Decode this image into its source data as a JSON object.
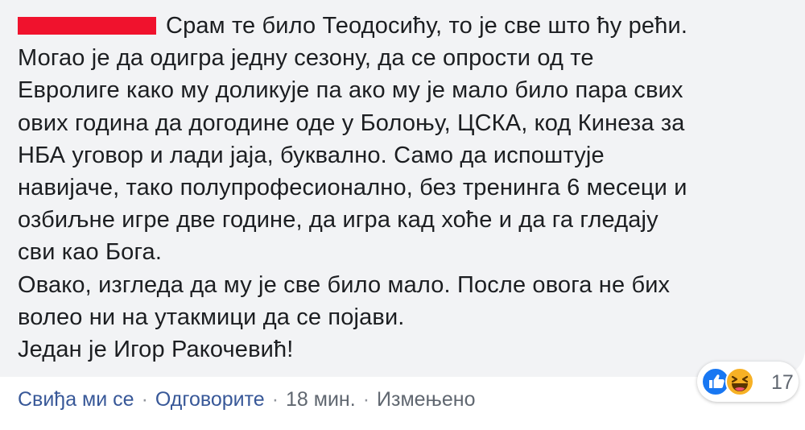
{
  "comment": {
    "first_line_text": "Срам те било Теодосићу, то је све што ћу рећи.",
    "lines": [
      "Могао је да одигра једну сезону, да се опрости од те",
      "Евролиге како му доликује па ако му је мало било пара свих",
      "ових година да догодине оде у Болоњу, ЦСКА, код Кинеза за",
      "НБА уговор и лади јаја, буквално. Само да испоштује",
      "навијаче, тако полупрофесионално, без тренинга 6 месеци и",
      "озбиљне игре две године, да игра кад хоће и да га гледају",
      "сви као Бога.",
      "Овако, изгледа да му је све било мало. После овога не бих",
      "волео ни на утакмици да се појави.",
      "Један је Игор Ракочевић!"
    ]
  },
  "reactions": {
    "icons": [
      "like-icon",
      "haha-icon"
    ],
    "count": "17",
    "colors": {
      "like": "#1877f2",
      "haha": "#f7b125"
    }
  },
  "actions": {
    "like_label": "Свиђа ми се",
    "reply_label": "Одговорите",
    "separator": "·",
    "time": "18 мин.",
    "edited": "Измењено"
  },
  "colors": {
    "redaction": "#f0122d",
    "bubble": "#f2f3f5",
    "link": "#385898"
  }
}
